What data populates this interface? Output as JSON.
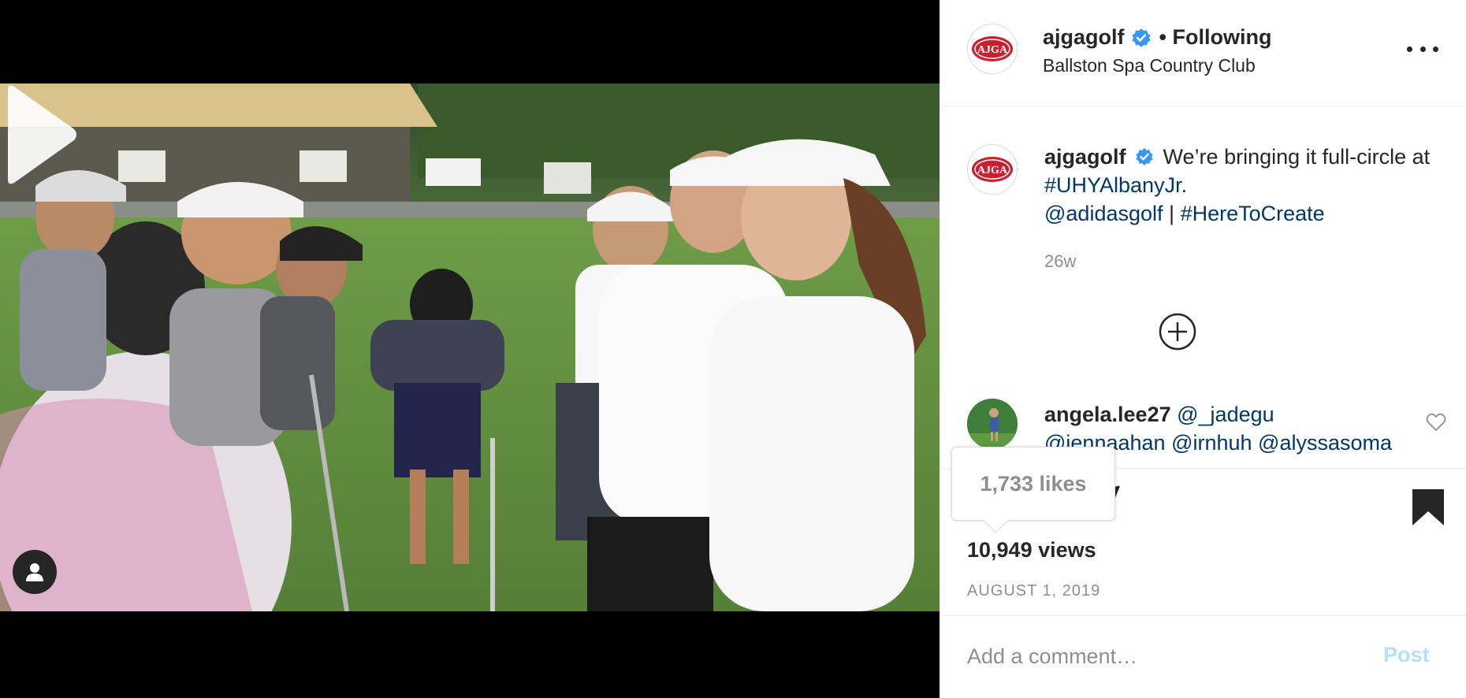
{
  "post": {
    "author": "ajgagolf",
    "following_label": "• Following",
    "location": "Ballston Spa Country Club",
    "logo_text": "AJGA"
  },
  "caption": {
    "username": "ajgagolf",
    "text_1": "We’re bringing it full-circle at",
    "hashtag_1": "#UHYAlbanyJr",
    "period": ".",
    "mention": "@adidasgolf",
    "separator": "|",
    "hashtag_2": "#HereToCreate",
    "time": "26w"
  },
  "comment": {
    "username": "angela.lee27",
    "mentions": [
      "@_jadegu",
      "@jennaahan",
      "@irnhuh",
      "@alyssasoma"
    ]
  },
  "stats": {
    "likes_tooltip": "1,733 likes",
    "views": "10,949 views",
    "date": "AUGUST 1, 2019"
  },
  "comment_box": {
    "placeholder": "Add a comment…",
    "post_label": "Post"
  },
  "icons": {
    "verified": "verified-badge-icon",
    "more": "more-options-icon",
    "load_more": "plus-circle-icon",
    "heart": "heart-icon",
    "comment": "comment-icon",
    "share": "share-icon",
    "bookmark": "bookmark-icon",
    "play": "play-icon",
    "user_tag": "user-tag-icon"
  },
  "colors": {
    "verified_blue": "#3897f0",
    "link": "#00376b",
    "muted": "#8e8e8e",
    "post_disabled": "#b2dffc",
    "logo_red": "#c8202f"
  }
}
